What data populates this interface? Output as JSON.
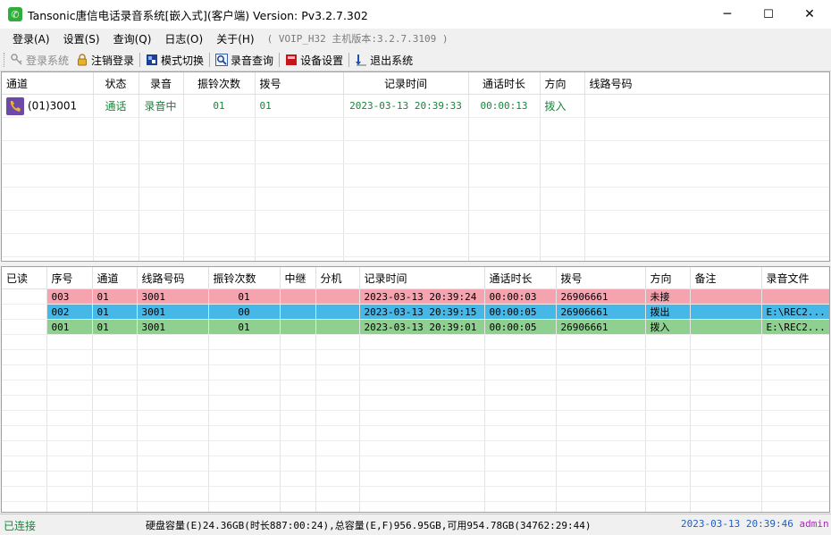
{
  "window": {
    "title": "Tansonic唐信电话录音系统[嵌入式](客户端) Version: Pv3.2.7.302",
    "minimize": "─",
    "maximize": "☐",
    "close": "✕"
  },
  "menu": {
    "items": [
      "登录(A)",
      "设置(S)",
      "查询(Q)",
      "日志(O)",
      "关于(H)"
    ],
    "info": "( VOIP_H32 主机版本:3.2.7.3109 )"
  },
  "toolbar": {
    "login": "登录系统",
    "logout": "注销登录",
    "mode": "模式切换",
    "query": "录音查询",
    "device": "设备设置",
    "exit": "退出系统"
  },
  "live": {
    "headers": [
      "通道",
      "状态",
      "录音",
      "振铃次数",
      "拨号",
      "记录时间",
      "通话时长",
      "方向",
      "线路号码"
    ],
    "rows": [
      {
        "channel": "(01)3001",
        "status": "通话",
        "recording": "录音中",
        "rings": "01",
        "dial": "01",
        "time": "2023-03-13 20:39:33",
        "duration": "00:00:13",
        "direction": "拨入",
        "line": ""
      }
    ]
  },
  "records": {
    "headers": [
      "已读",
      "序号",
      "通道",
      "线路号码",
      "振铃次数",
      "中继",
      "分机",
      "记录时间",
      "通话时长",
      "拨号",
      "方向",
      "备注",
      "录音文件"
    ],
    "rows": [
      {
        "read": "",
        "seq": "003",
        "channel": "01",
        "line": "3001",
        "rings": "01",
        "trunk": "",
        "ext": "",
        "time": "2023-03-13 20:39:24",
        "duration": "00:00:03",
        "dial": "26906661",
        "direction": "未接",
        "note": "",
        "file": ""
      },
      {
        "read": "",
        "seq": "002",
        "channel": "01",
        "line": "3001",
        "rings": "00",
        "trunk": "",
        "ext": "",
        "time": "2023-03-13 20:39:15",
        "duration": "00:00:05",
        "dial": "26906661",
        "direction": "拨出",
        "note": "",
        "file": "E:\\REC2..."
      },
      {
        "read": "",
        "seq": "001",
        "channel": "01",
        "line": "3001",
        "rings": "01",
        "trunk": "",
        "ext": "",
        "time": "2023-03-13 20:39:01",
        "duration": "00:00:05",
        "dial": "26906661",
        "direction": "拨入",
        "note": "",
        "file": "E:\\REC2..."
      }
    ]
  },
  "status": {
    "connection": "已连接",
    "disk": "硬盘容量(E)24.36GB(时长887:00:24),总容量(E,F)956.95GB,可用954.78GB(34762:29:44)",
    "datetime": "2023-03-13 20:39:46",
    "user": "admin"
  },
  "colors": {
    "missed_row": "#f4a3af",
    "outgoing_row": "#46b8e8",
    "incoming_row": "#8fcf8f",
    "status_green": "#16863a"
  },
  "icons": {
    "app": "phone-app-icon",
    "login": "key-icon",
    "logout": "lock-icon",
    "mode": "mode-switch-icon",
    "query": "magnifier-icon",
    "device": "device-settings-icon",
    "exit": "exit-icon",
    "channel": "phone-handset-icon"
  }
}
